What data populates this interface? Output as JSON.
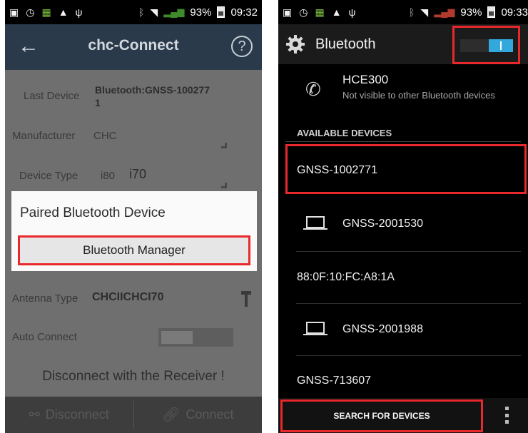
{
  "left_screen": {
    "status_bar": {
      "battery": "93%",
      "time": "09:32"
    },
    "app_bar": {
      "title": "chc-Connect",
      "help": "?"
    },
    "form": {
      "last_device_label": "Last Device",
      "last_device_value_line1": "Bluetooth:GNSS-100277",
      "last_device_value_line2": "1",
      "manufacturer_label": "Manufacturer",
      "manufacturer_value": "CHC",
      "device_type_label": "Device Type",
      "device_type_value_a": "i80",
      "device_type_value_b": "i70",
      "antenna_type_label": "Antenna Type",
      "antenna_type_value": "CHCIICHCI70",
      "auto_connect_label": "Auto Connect"
    },
    "dialog": {
      "title": "Paired Bluetooth Device",
      "button": "Bluetooth Manager"
    },
    "status_message": "Disconnect with the Receiver !",
    "bottom_bar": {
      "disconnect": "Disconnect",
      "connect": "Connect"
    }
  },
  "right_screen": {
    "status_bar": {
      "battery": "93%",
      "time": "09:33"
    },
    "header": {
      "title": "Bluetooth",
      "switch_on": true
    },
    "own_device": {
      "name": "HCE300",
      "subtitle": "Not visible to other Bluetooth devices"
    },
    "section_header": "AVAILABLE DEVICES",
    "devices": [
      {
        "name": "GNSS-1002771",
        "icon": ""
      },
      {
        "name": "GNSS-2001530",
        "icon": "laptop-icon"
      },
      {
        "name": "88:0F:10:FC:A8:1A",
        "icon": ""
      },
      {
        "name": "GNSS-2001988",
        "icon": "laptop-icon"
      },
      {
        "name": "GNSS-713607",
        "icon": ""
      }
    ],
    "bottom_bar": {
      "search": "SEARCH FOR DEVICES"
    }
  },
  "colors": {
    "highlight_red": "#e8282c",
    "switch_blue": "#33a8dc",
    "app_bar": "#2a3a4a"
  }
}
